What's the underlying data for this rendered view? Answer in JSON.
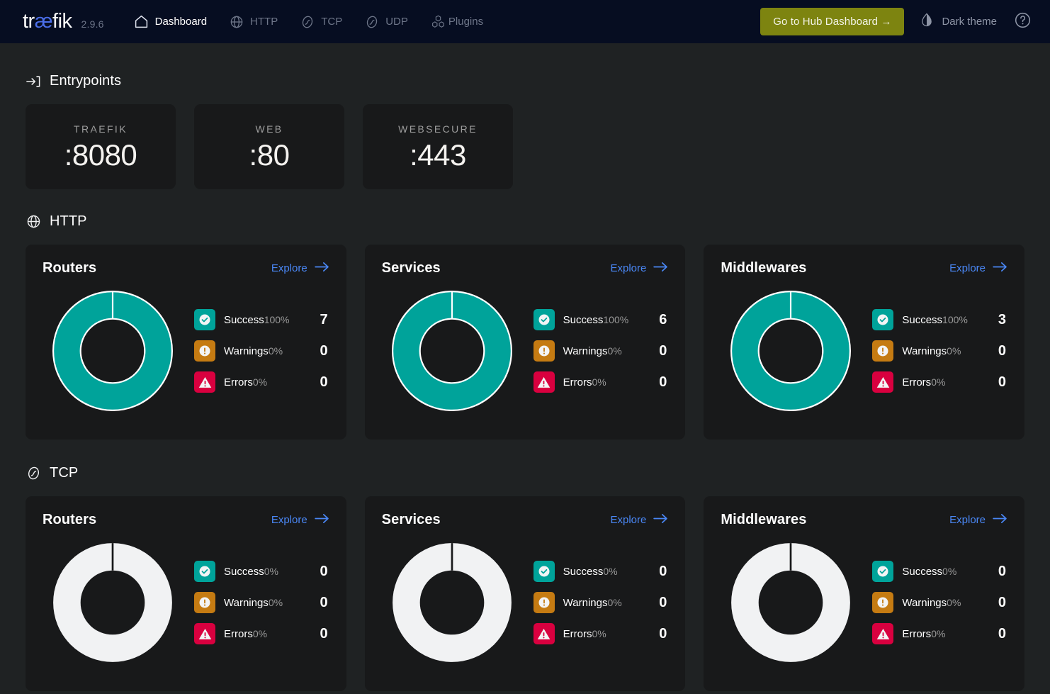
{
  "navbar": {
    "logo_text_1": "tr",
    "logo_text_ae": "æ",
    "logo_text_2": "fik",
    "version": "2.9.6",
    "links": [
      {
        "label": "Dashboard",
        "icon": "home-icon",
        "active": true
      },
      {
        "label": "HTTP",
        "icon": "globe-icon",
        "active": false
      },
      {
        "label": "TCP",
        "icon": "tcp-icon",
        "active": false
      },
      {
        "label": "UDP",
        "icon": "udp-icon",
        "active": false
      },
      {
        "label": "Plugins",
        "icon": "plugins-icon",
        "active": false
      }
    ],
    "hub_button": "Go to Hub Dashboard  →",
    "theme_label": "Dark theme",
    "theme_icon": "contrast-droplet-icon",
    "help_icon": "help-circle-icon"
  },
  "colors": {
    "navbar_bg": "#060d21",
    "page_bg": "#1f2223",
    "card_bg": "#18191a",
    "accent_blue": "#4a87f5",
    "logo_accent": "#4b6ee8",
    "hub_button_bg": "#7d8410",
    "success": "#00a39a",
    "warning": "#c57b12",
    "error": "#d9003f",
    "empty_donut": "#f1f2f3"
  },
  "entrypoints": {
    "section_title": "Entrypoints",
    "section_icon": "arrow-into-bracket-icon",
    "items": [
      {
        "name": "TRAEFIK",
        "port": ":8080"
      },
      {
        "name": "WEB",
        "port": ":80"
      },
      {
        "name": "WEBSECURE",
        "port": ":443"
      }
    ]
  },
  "http": {
    "section_title": "HTTP",
    "section_icon": "globe-icon",
    "explore_label": "Explore",
    "cards": [
      {
        "title": "Routers",
        "stats": [
          {
            "label": "Success",
            "percent": "100%",
            "value": "7",
            "icon": "check-circle-icon",
            "kind": "success"
          },
          {
            "label": "Warnings",
            "percent": "0%",
            "value": "0",
            "icon": "exclamation-circle-icon",
            "kind": "warning"
          },
          {
            "label": "Errors",
            "percent": "0%",
            "value": "0",
            "icon": "warning-triangle-icon",
            "kind": "error"
          }
        ]
      },
      {
        "title": "Services",
        "stats": [
          {
            "label": "Success",
            "percent": "100%",
            "value": "6",
            "icon": "check-circle-icon",
            "kind": "success"
          },
          {
            "label": "Warnings",
            "percent": "0%",
            "value": "0",
            "icon": "exclamation-circle-icon",
            "kind": "warning"
          },
          {
            "label": "Errors",
            "percent": "0%",
            "value": "0",
            "icon": "warning-triangle-icon",
            "kind": "error"
          }
        ]
      },
      {
        "title": "Middlewares",
        "stats": [
          {
            "label": "Success",
            "percent": "100%",
            "value": "3",
            "icon": "check-circle-icon",
            "kind": "success"
          },
          {
            "label": "Warnings",
            "percent": "0%",
            "value": "0",
            "icon": "exclamation-circle-icon",
            "kind": "warning"
          },
          {
            "label": "Errors",
            "percent": "0%",
            "value": "0",
            "icon": "warning-triangle-icon",
            "kind": "error"
          }
        ]
      }
    ]
  },
  "tcp": {
    "section_title": "TCP",
    "section_icon": "tcp-icon",
    "explore_label": "Explore",
    "cards": [
      {
        "title": "Routers",
        "stats": [
          {
            "label": "Success",
            "percent": "0%",
            "value": "0",
            "icon": "check-circle-icon",
            "kind": "success"
          },
          {
            "label": "Warnings",
            "percent": "0%",
            "value": "0",
            "icon": "exclamation-circle-icon",
            "kind": "warning"
          },
          {
            "label": "Errors",
            "percent": "0%",
            "value": "0",
            "icon": "warning-triangle-icon",
            "kind": "error"
          }
        ]
      },
      {
        "title": "Services",
        "stats": [
          {
            "label": "Success",
            "percent": "0%",
            "value": "0",
            "icon": "check-circle-icon",
            "kind": "success"
          },
          {
            "label": "Warnings",
            "percent": "0%",
            "value": "0",
            "icon": "exclamation-circle-icon",
            "kind": "warning"
          },
          {
            "label": "Errors",
            "percent": "0%",
            "value": "0",
            "icon": "warning-triangle-icon",
            "kind": "error"
          }
        ]
      },
      {
        "title": "Middlewares",
        "stats": [
          {
            "label": "Success",
            "percent": "0%",
            "value": "0",
            "icon": "check-circle-icon",
            "kind": "success"
          },
          {
            "label": "Warnings",
            "percent": "0%",
            "value": "0",
            "icon": "exclamation-circle-icon",
            "kind": "warning"
          },
          {
            "label": "Errors",
            "percent": "0%",
            "value": "0",
            "icon": "warning-triangle-icon",
            "kind": "error"
          }
        ]
      }
    ]
  },
  "chart_data": [
    {
      "type": "pie",
      "title": "HTTP Routers",
      "labels": [
        "Success",
        "Warnings",
        "Errors"
      ],
      "values": [
        7,
        0,
        0
      ],
      "percents": [
        100,
        0,
        0
      ],
      "colors": [
        "#00a39a",
        "#c57b12",
        "#d9003f"
      ]
    },
    {
      "type": "pie",
      "title": "HTTP Services",
      "labels": [
        "Success",
        "Warnings",
        "Errors"
      ],
      "values": [
        6,
        0,
        0
      ],
      "percents": [
        100,
        0,
        0
      ],
      "colors": [
        "#00a39a",
        "#c57b12",
        "#d9003f"
      ]
    },
    {
      "type": "pie",
      "title": "HTTP Middlewares",
      "labels": [
        "Success",
        "Warnings",
        "Errors"
      ],
      "values": [
        3,
        0,
        0
      ],
      "percents": [
        100,
        0,
        0
      ],
      "colors": [
        "#00a39a",
        "#c57b12",
        "#d9003f"
      ]
    },
    {
      "type": "pie",
      "title": "TCP Routers",
      "labels": [
        "Success",
        "Warnings",
        "Errors"
      ],
      "values": [
        0,
        0,
        0
      ],
      "percents": [
        0,
        0,
        0
      ],
      "colors": [
        "#f1f2f3"
      ]
    },
    {
      "type": "pie",
      "title": "TCP Services",
      "labels": [
        "Success",
        "Warnings",
        "Errors"
      ],
      "values": [
        0,
        0,
        0
      ],
      "percents": [
        0,
        0,
        0
      ],
      "colors": [
        "#f1f2f3"
      ]
    },
    {
      "type": "pie",
      "title": "TCP Middlewares",
      "labels": [
        "Success",
        "Warnings",
        "Errors"
      ],
      "values": [
        0,
        0,
        0
      ],
      "percents": [
        0,
        0,
        0
      ],
      "colors": [
        "#f1f2f3"
      ]
    }
  ]
}
